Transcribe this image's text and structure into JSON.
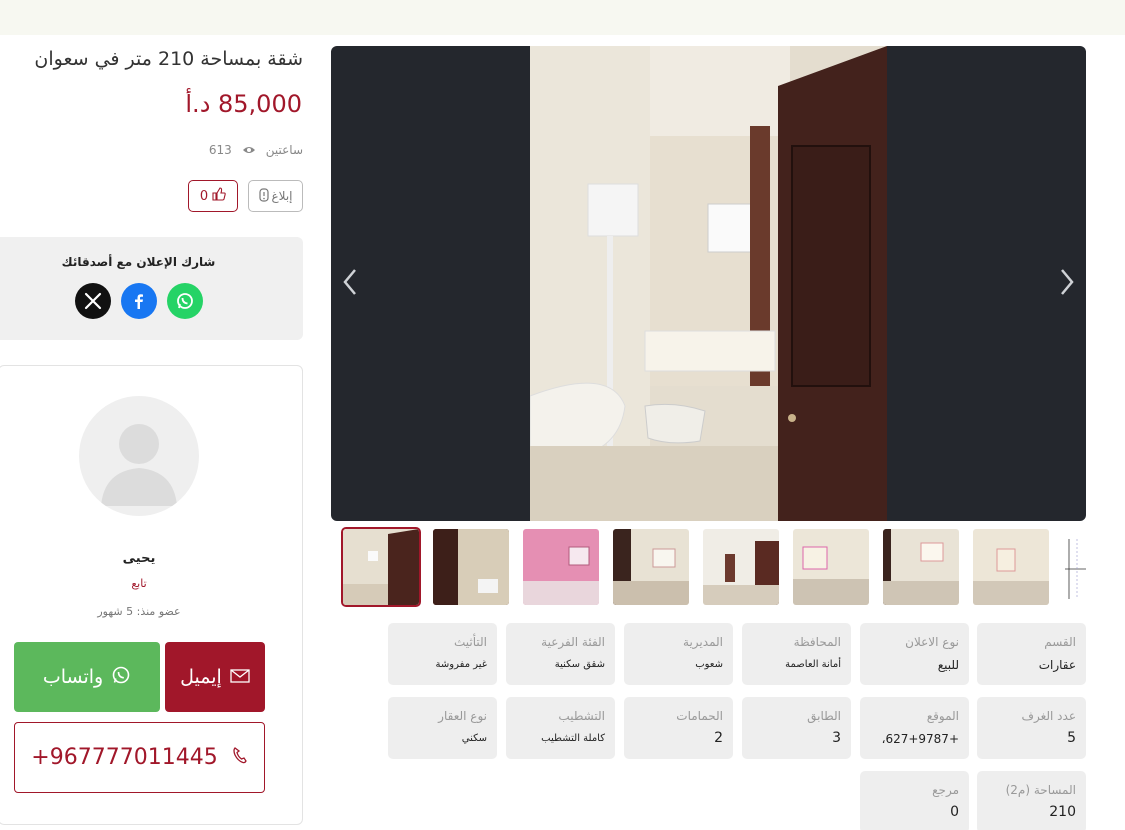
{
  "listing": {
    "title": "شقة بمساحة 210 متر في سعوان",
    "price": "85,000 د.أ",
    "time_ago": "ساعتين",
    "views": "613",
    "report_label": "إبلاغ",
    "like_count": "0"
  },
  "share": {
    "title": "شارك الإعلان مع أصدقائك",
    "icons": [
      "x-icon",
      "facebook-icon",
      "whatsapp-icon"
    ]
  },
  "seller": {
    "name": "يحيى",
    "follow_label": "تابع",
    "member_since": "عضو منذ: 5 شهور",
    "whatsapp_label": "واتساب",
    "email_label": "إيميل",
    "phone": "+967777011445"
  },
  "attributes": [
    {
      "label": "القسم",
      "value": "عقارات"
    },
    {
      "label": "نوع الاعلان",
      "value": "للبيع"
    },
    {
      "label": "المحافظة",
      "value": "أمانة العاصمة"
    },
    {
      "label": "المديرية",
      "value": "شعوب"
    },
    {
      "label": "الفئة الفرعية",
      "value": "شقق سكنية"
    },
    {
      "label": "التأثيث",
      "value": "غير مفروشة"
    },
    {
      "label": "عدد الغرف",
      "value": "5"
    },
    {
      "label": "الموقع",
      "value": "+627+9787،"
    },
    {
      "label": "الطابق",
      "value": "3"
    },
    {
      "label": "الحمامات",
      "value": "2"
    },
    {
      "label": "التشطيب",
      "value": "كاملة التشطيب"
    },
    {
      "label": "نوع العقار",
      "value": "سكني"
    },
    {
      "label": "المساحة (م2)",
      "value": "210"
    },
    {
      "label": "مرجع",
      "value": "0"
    }
  ],
  "colors": {
    "accent": "#a1172a",
    "whatsapp": "#5cb85c",
    "tile_bg": "#eeeeee"
  }
}
